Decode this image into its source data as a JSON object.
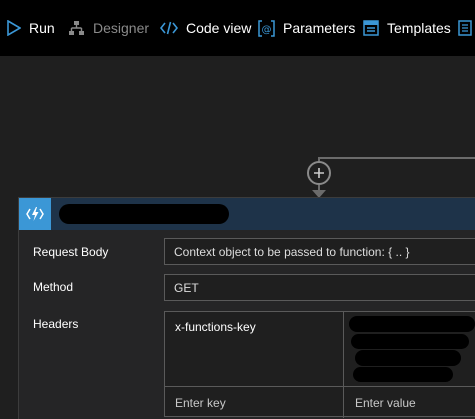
{
  "toolbar": {
    "run_label": "Run",
    "designer_label": "Designer",
    "code_view_label": "Code view",
    "parameters_label": "Parameters",
    "templates_label": "Templates"
  },
  "action": {
    "title": "",
    "fields": {
      "request_body_label": "Request Body",
      "request_body_value": "Context object to be passed to function: { .. }",
      "method_label": "Method",
      "method_value": "GET",
      "headers_label": "Headers",
      "headers": {
        "key_1": "x-functions-key",
        "key_placeholder": "Enter key",
        "value_placeholder": "Enter value"
      }
    }
  },
  "colors": {
    "toolbar_bg": "#000000",
    "canvas_bg": "#1f1f1f",
    "accent_blue": "#3b97d6",
    "card_header_bg": "#1e3349"
  },
  "icons": [
    "run-icon",
    "designer-icon",
    "code-view-icon",
    "parameters-icon",
    "templates-icon",
    "add-step-icon",
    "azure-function-icon"
  ]
}
